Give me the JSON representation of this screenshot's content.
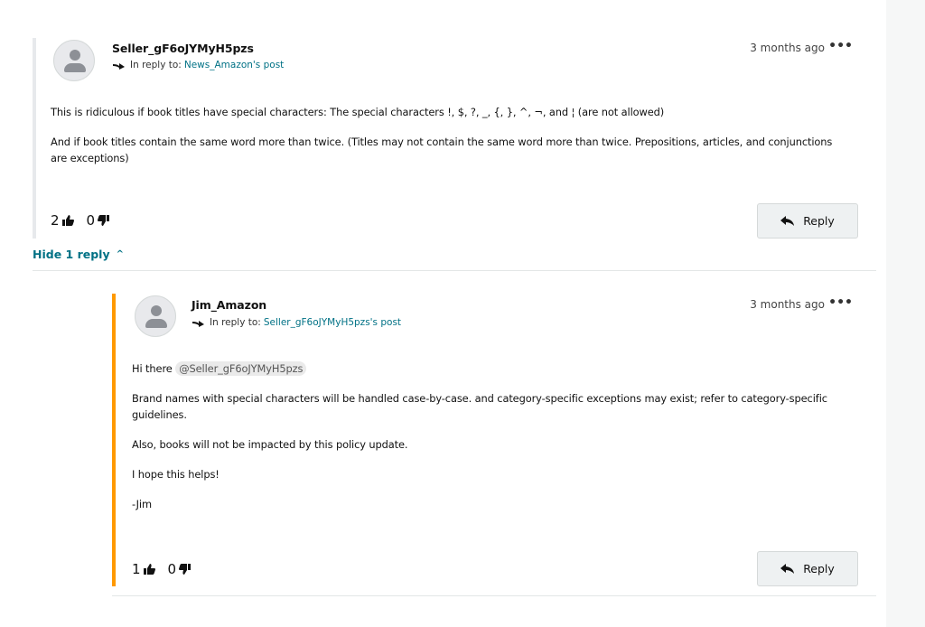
{
  "comments": [
    {
      "author": "Seller_gF6oJYMyH5pzs",
      "reply_prefix": "In reply to:",
      "reply_target": "News_Amazon's post",
      "timestamp": "3 months ago",
      "more_label": "•••",
      "paragraphs": [
        "This is ridiculous if book titles have special characters: The special characters !, $, ?, _, {, }, ^, ¬, and ¦ (are not allowed)",
        "And if book titles contain the same word more than twice. (Titles may not contain the same word more than twice. Prepositions, articles, and conjunctions are exceptions)"
      ],
      "upvotes": "2",
      "downvotes": "0",
      "reply_label": "Reply"
    },
    {
      "author": "Jim_Amazon",
      "reply_prefix": "In reply to:",
      "reply_target": "Seller_gF6oJYMyH5pzs's post",
      "timestamp": "3 months ago",
      "more_label": "•••",
      "greeting": "Hi there",
      "mention": "@Seller_gF6oJYMyH5pzs",
      "paragraphs": [
        "Brand names with special characters will be handled case-by-case. and category-specific exceptions may exist; refer to category-specific guidelines.",
        "Also, books will not be impacted by this policy update.",
        "I hope this helps!",
        "-Jim"
      ],
      "upvotes": "1",
      "downvotes": "0",
      "reply_label": "Reply"
    }
  ],
  "hide_replies_label": "Hide 1 reply",
  "hide_replies_icon": "caret-up-icon",
  "colors": {
    "accent_orange": "#ff9900",
    "link_teal": "#007185",
    "button_bg": "#eef1f2"
  }
}
